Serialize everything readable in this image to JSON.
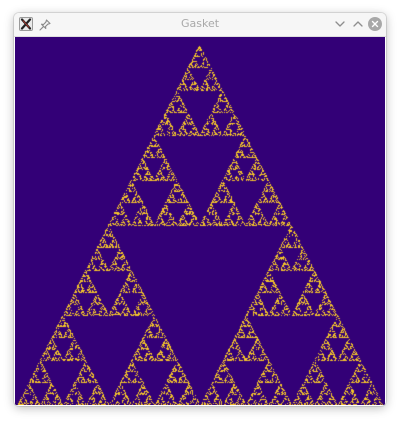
{
  "window": {
    "title": "Gasket"
  },
  "icons": {
    "app": "x-app-icon",
    "pin": "pin-icon",
    "minimize": "chevron-down-icon",
    "maximize": "chevron-up-icon",
    "close": "close-icon"
  },
  "colors": {
    "background": "#330077",
    "points": "#f5c52a"
  }
}
